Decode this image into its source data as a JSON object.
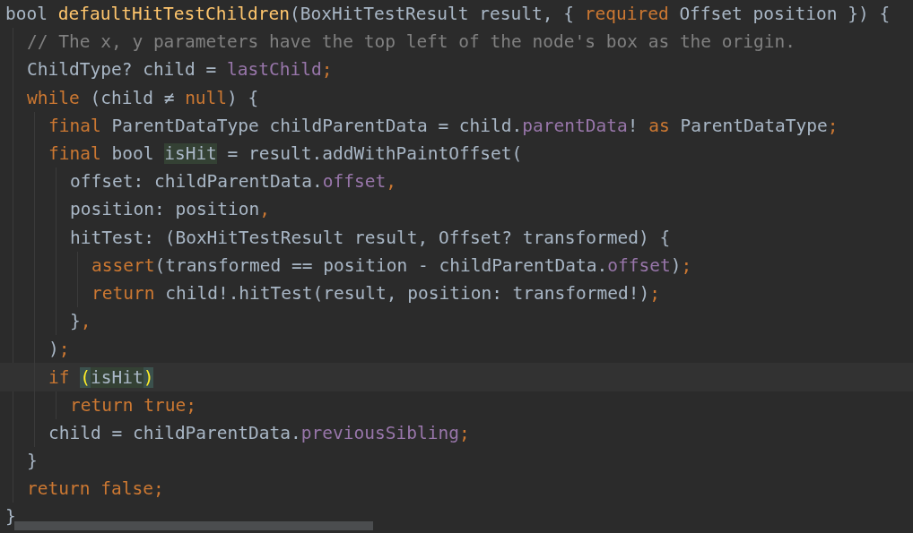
{
  "editor": {
    "lines": [
      {
        "kind": "code",
        "tokens": [
          {
            "kind": "plain",
            "text": "bool "
          },
          {
            "kind": "function",
            "text": "defaultHitTestChildren"
          },
          {
            "kind": "plain",
            "text": "(BoxHitTestResult result, { "
          },
          {
            "kind": "keyword",
            "text": "required"
          },
          {
            "kind": "plain",
            "text": " Offset position }) {"
          }
        ],
        "children": [
          {
            "kind": "code",
            "tokens": [
              {
                "kind": "comment",
                "text": "// The x, y parameters have the top left of the node's box as the origin."
              }
            ]
          },
          {
            "kind": "code",
            "tokens": [
              {
                "kind": "plain",
                "text": "ChildType? child = "
              },
              {
                "kind": "field",
                "text": "lastChild"
              },
              {
                "kind": "keyword",
                "text": ";"
              }
            ]
          },
          {
            "kind": "code",
            "tokens": [
              {
                "kind": "keyword",
                "text": "while "
              },
              {
                "kind": "plain",
                "text": "(child ≠ "
              },
              {
                "kind": "keyword",
                "text": "null"
              },
              {
                "kind": "plain",
                "text": ") {"
              }
            ],
            "children": [
              {
                "kind": "code",
                "tokens": [
                  {
                    "kind": "keyword",
                    "text": "final "
                  },
                  {
                    "kind": "plain",
                    "text": "ParentDataType childParentData = child."
                  },
                  {
                    "kind": "field",
                    "text": "parentData"
                  },
                  {
                    "kind": "plain",
                    "text": "! "
                  },
                  {
                    "kind": "keyword",
                    "text": "as "
                  },
                  {
                    "kind": "plain",
                    "text": "ParentDataType"
                  },
                  {
                    "kind": "keyword",
                    "text": ";"
                  }
                ]
              },
              {
                "kind": "code",
                "tokens": [
                  {
                    "kind": "keyword",
                    "text": "final "
                  },
                  {
                    "kind": "plain",
                    "text": "bool "
                  },
                  {
                    "kind": "usage",
                    "text": "isHit"
                  },
                  {
                    "kind": "plain",
                    "text": " = result.addWithPaintOffset("
                  }
                ],
                "children": [
                  {
                    "kind": "code",
                    "tokens": [
                      {
                        "kind": "plain",
                        "text": "offset: childParentData."
                      },
                      {
                        "kind": "field",
                        "text": "offset"
                      },
                      {
                        "kind": "keyword",
                        "text": ","
                      }
                    ]
                  },
                  {
                    "kind": "code",
                    "tokens": [
                      {
                        "kind": "plain",
                        "text": "position: position"
                      },
                      {
                        "kind": "keyword",
                        "text": ","
                      }
                    ]
                  },
                  {
                    "kind": "code",
                    "tokens": [
                      {
                        "kind": "plain",
                        "text": "hitTest: (BoxHitTestResult result, Offset? transformed) {"
                      }
                    ],
                    "children": [
                      {
                        "kind": "code",
                        "tokens": [
                          {
                            "kind": "keyword",
                            "text": "assert"
                          },
                          {
                            "kind": "plain",
                            "text": "(transformed == position - childParentData."
                          },
                          {
                            "kind": "field",
                            "text": "offset"
                          },
                          {
                            "kind": "plain",
                            "text": ")"
                          },
                          {
                            "kind": "keyword",
                            "text": ";"
                          }
                        ]
                      },
                      {
                        "kind": "code",
                        "tokens": [
                          {
                            "kind": "keyword",
                            "text": "return "
                          },
                          {
                            "kind": "plain",
                            "text": "child!.hitTest(result, position: transformed!)"
                          },
                          {
                            "kind": "keyword",
                            "text": ";"
                          }
                        ]
                      }
                    ]
                  },
                  {
                    "kind": "code",
                    "tokens": [
                      {
                        "kind": "plain",
                        "text": "}"
                      },
                      {
                        "kind": "keyword",
                        "text": ","
                      }
                    ]
                  }
                ]
              },
              {
                "kind": "code",
                "tokens": [
                  {
                    "kind": "plain",
                    "text": ")"
                  },
                  {
                    "kind": "keyword",
                    "text": ";"
                  }
                ]
              },
              {
                "kind": "caret_line",
                "tokens": [
                  {
                    "kind": "keyword",
                    "text": "if "
                  },
                  {
                    "kind": "brace",
                    "text": "("
                  },
                  {
                    "kind": "usage",
                    "text": "isHit"
                  },
                  {
                    "kind": "brace",
                    "text": ")"
                  }
                ],
                "children": [
                  {
                    "kind": "code",
                    "tokens": [
                      {
                        "kind": "keyword",
                        "text": "return true;"
                      }
                    ]
                  }
                ]
              },
              {
                "kind": "code",
                "tokens": [
                  {
                    "kind": "plain",
                    "text": "child = childParentData."
                  },
                  {
                    "kind": "field",
                    "text": "previousSibling"
                  },
                  {
                    "kind": "keyword",
                    "text": ";"
                  }
                ]
              }
            ]
          },
          {
            "kind": "code",
            "tokens": [
              {
                "kind": "plain",
                "text": "}"
              }
            ]
          },
          {
            "kind": "code",
            "tokens": [
              {
                "kind": "keyword",
                "text": "return false;"
              }
            ]
          }
        ]
      },
      {
        "kind": "code",
        "tokens": [
          {
            "kind": "plain",
            "text": "}"
          }
        ]
      }
    ]
  }
}
